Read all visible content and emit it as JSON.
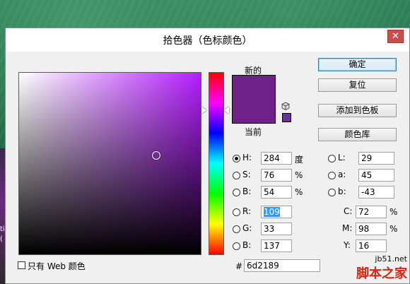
{
  "dialog": {
    "title": "拾色器（色标颜色）",
    "close_glyph": "✕"
  },
  "left_strip_text": "ti\n(",
  "swatches": {
    "new_label": "新的",
    "current_label": "当前",
    "new_color": "#6d2189",
    "current_color": "#6d2189",
    "websafe_color": "#663399"
  },
  "buttons": {
    "ok": "确定",
    "reset": "复位",
    "add_to_swatches": "添加到色板",
    "color_library": "颜色库"
  },
  "hsb": {
    "h_label": "H:",
    "h_value": "284",
    "h_unit": "度",
    "s_label": "S:",
    "s_value": "76",
    "s_unit": "%",
    "b_label": "B:",
    "b_value": "54",
    "b_unit": "%"
  },
  "rgb": {
    "r_label": "R:",
    "r_value": "109",
    "g_label": "G:",
    "g_value": "33",
    "b_label": "B:",
    "b_value": "137"
  },
  "lab": {
    "l_label": "L:",
    "l_value": "29",
    "a_label": "a:",
    "a_value": "45",
    "b_label": "b:",
    "b_value": "-43"
  },
  "cmyk": {
    "c_label": "C:",
    "c_value": "72",
    "c_unit": "%",
    "m_label": "M:",
    "m_value": "98",
    "m_unit": "%",
    "y_label": "Y:",
    "y_value": "16"
  },
  "hex": {
    "label": "#",
    "value": "6d2189"
  },
  "web_only_label": "只有 Web 颜色",
  "field": {
    "hue_color": "#b51eff",
    "saturation": 0.76,
    "brightness": 0.54,
    "hue_degrees": 284
  },
  "watermark": {
    "url": "jb51.net",
    "text": "脚本之家"
  }
}
